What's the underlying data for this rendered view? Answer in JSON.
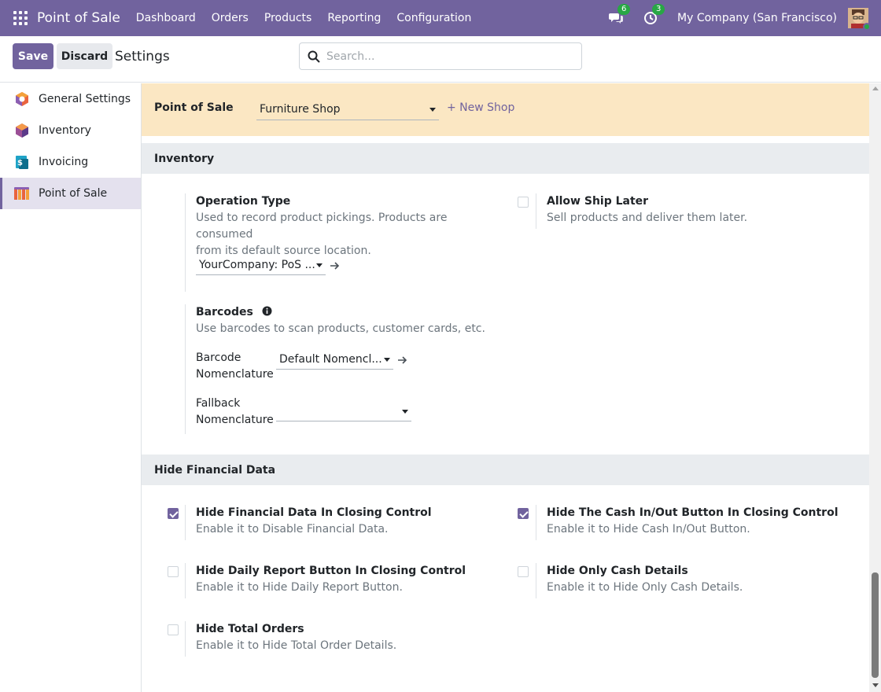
{
  "navbar": {
    "brand": "Point of Sale",
    "menu": [
      "Dashboard",
      "Orders",
      "Products",
      "Reporting",
      "Configuration"
    ],
    "messages_count": "6",
    "activities_count": "3",
    "company": "My Company (San Francisco)",
    "accent": "#71639e"
  },
  "control_panel": {
    "save_label": "Save",
    "discard_label": "Discard",
    "title": "Settings",
    "search_placeholder": "Search..."
  },
  "sidebar": {
    "items": [
      {
        "label": "General Settings",
        "icon": "general-settings-icon",
        "active": false
      },
      {
        "label": "Inventory",
        "icon": "inventory-app-icon",
        "active": false
      },
      {
        "label": "Invoicing",
        "icon": "invoicing-app-icon",
        "active": false
      },
      {
        "label": "Point of Sale",
        "icon": "pos-app-icon",
        "active": true
      }
    ]
  },
  "shop_bar": {
    "label": "Point of Sale",
    "selected_shop": "Furniture Shop",
    "new_shop": "+ New Shop"
  },
  "inventory_section": {
    "title": "Inventory",
    "operation_type": {
      "title": "Operation Type",
      "desc_line1": "Used to record product pickings. Products are consumed",
      "desc_line2": "from its default source location.",
      "value": "YourCompany: PoS ..."
    },
    "allow_ship_later": {
      "title": "Allow Ship Later",
      "desc": "Sell products and deliver them later.",
      "checked": false
    },
    "barcodes": {
      "title": "Barcodes",
      "desc": "Use barcodes to scan products, customer cards, etc.",
      "nomenclature_label_1": "Barcode",
      "nomenclature_label_2": "Nomenclature",
      "nomenclature_value": "Default Nomencl...",
      "fallback_label_1": "Fallback",
      "fallback_label_2": "Nomenclature",
      "fallback_value": ""
    }
  },
  "financial_section": {
    "title": "Hide Financial Data",
    "settings": [
      {
        "title": "Hide Financial Data In Closing Control",
        "desc": "Enable it to Disable Financial Data.",
        "checked": true
      },
      {
        "title": "Hide The Cash In/Out Button In Closing Control",
        "desc": "Enable it to Hide Cash In/Out Button.",
        "checked": true
      },
      {
        "title": "Hide Daily Report Button In Closing Control",
        "desc": "Enable it to Hide Daily Report Button.",
        "checked": false
      },
      {
        "title": "Hide Only Cash Details",
        "desc": "Enable it to Hide Only Cash Details.",
        "checked": false
      },
      {
        "title": "Hide Total Orders",
        "desc": "Enable it to Hide Total Order Details.",
        "checked": false
      }
    ]
  }
}
